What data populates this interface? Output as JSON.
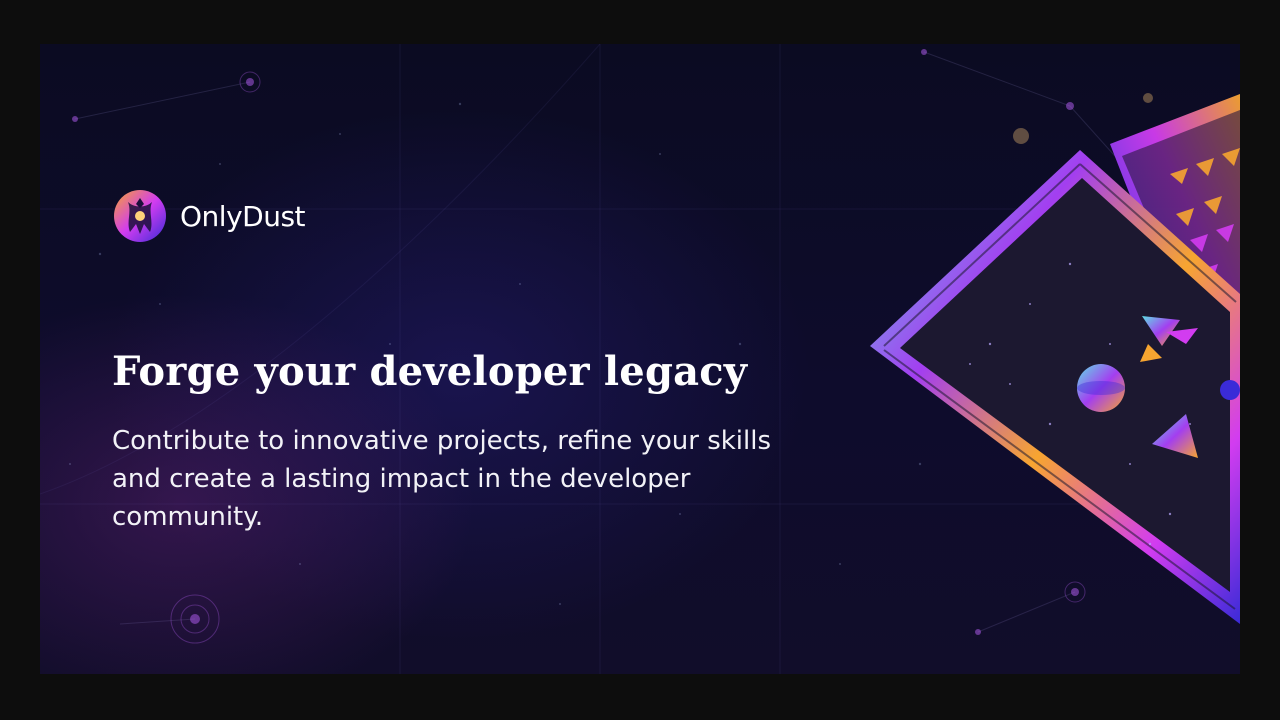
{
  "brand": {
    "name": "OnlyDust",
    "logo_icon": "onlydust-logo-icon"
  },
  "hero": {
    "headline": "Forge your developer legacy",
    "subtext": "Contribute to innovative projects, refine your skills and create a lasting impact in the developer community."
  },
  "artwork": {
    "icon": "iridescent-cards-illustration"
  },
  "colors": {
    "background": "#0e0c2c",
    "accent_purple": "#a33ef0",
    "accent_orange": "#f7a530",
    "accent_cyan": "#5fe0e6"
  }
}
